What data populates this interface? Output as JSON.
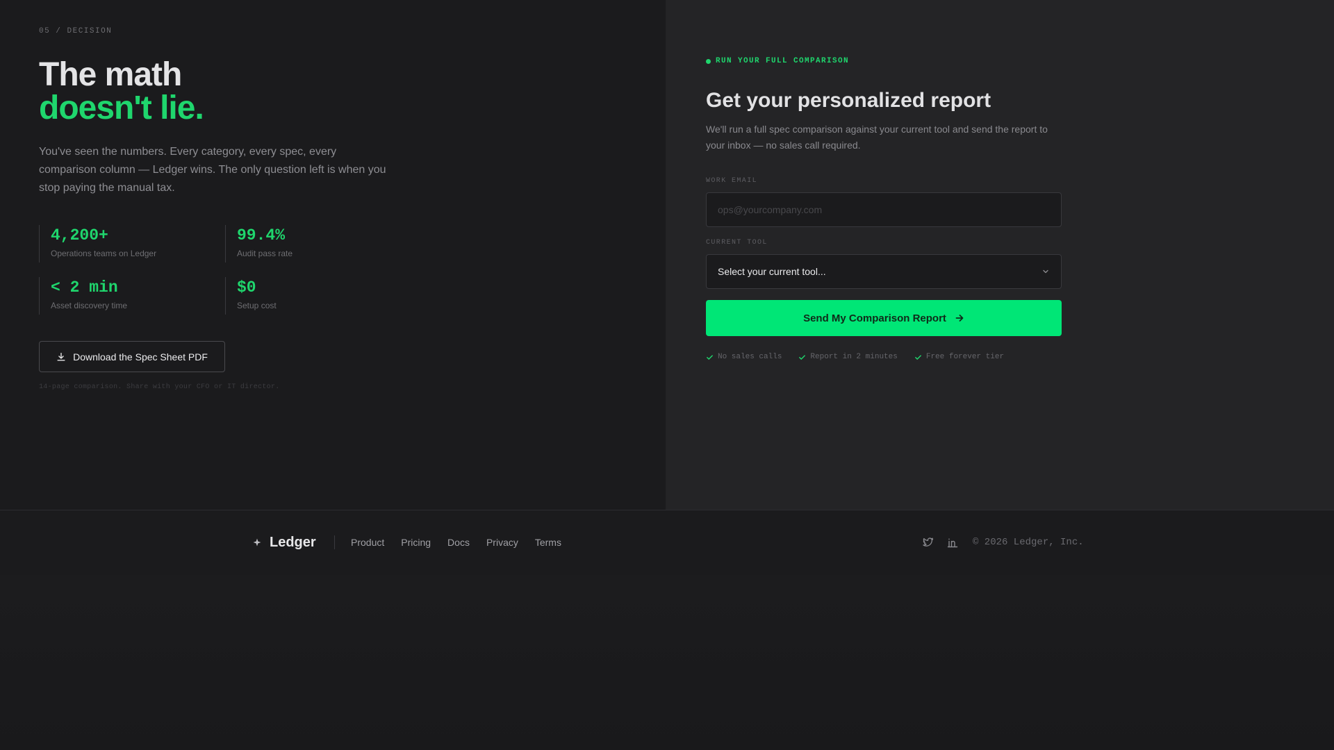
{
  "left": {
    "section_label": "05 / DECISION",
    "headline_line1": "The math",
    "headline_line2": "doesn't lie.",
    "lead": "You've seen the numbers. Every category, every spec, every comparison column — Ledger wins. The only question left is when you stop paying the manual tax.",
    "stats": [
      {
        "value": "4,200+",
        "label": "Operations teams on Ledger"
      },
      {
        "value": "99.4%",
        "label": "Audit pass rate"
      },
      {
        "value": "< 2 min",
        "label": "Asset discovery time"
      },
      {
        "value": "$0",
        "label": "Setup cost"
      }
    ],
    "download_label": "Download the Spec Sheet PDF",
    "download_icon": "download-icon",
    "download_note": "14-page comparison. Share with your CFO or IT director."
  },
  "form": {
    "eyebrow": "RUN YOUR FULL COMPARISON",
    "title": "Get your personalized report",
    "subtitle": "We'll run a full spec comparison against your current tool and send the report to your inbox — no sales call required.",
    "email_label": "WORK EMAIL",
    "email_placeholder": "ops@yourcompany.com",
    "email_value": "",
    "tool_label": "CURRENT TOOL",
    "tool_selected": "Select your current tool...",
    "submit_label": "Send My Comparison Report",
    "submit_icon": "arrow-right-icon",
    "trust": [
      "No sales calls",
      "Report in 2 minutes",
      "Free forever tier"
    ]
  },
  "footer": {
    "brand": "Ledger",
    "nav": [
      "Product",
      "Pricing",
      "Docs",
      "Privacy",
      "Terms"
    ],
    "social_icons": [
      "twitter-icon",
      "linkedin-icon"
    ],
    "copyright": "© 2026 Ledger, Inc."
  },
  "colors": {
    "accent": "#1fd66d",
    "button": "#00e676",
    "background": "#1b1b1d",
    "panel": "#242426"
  }
}
